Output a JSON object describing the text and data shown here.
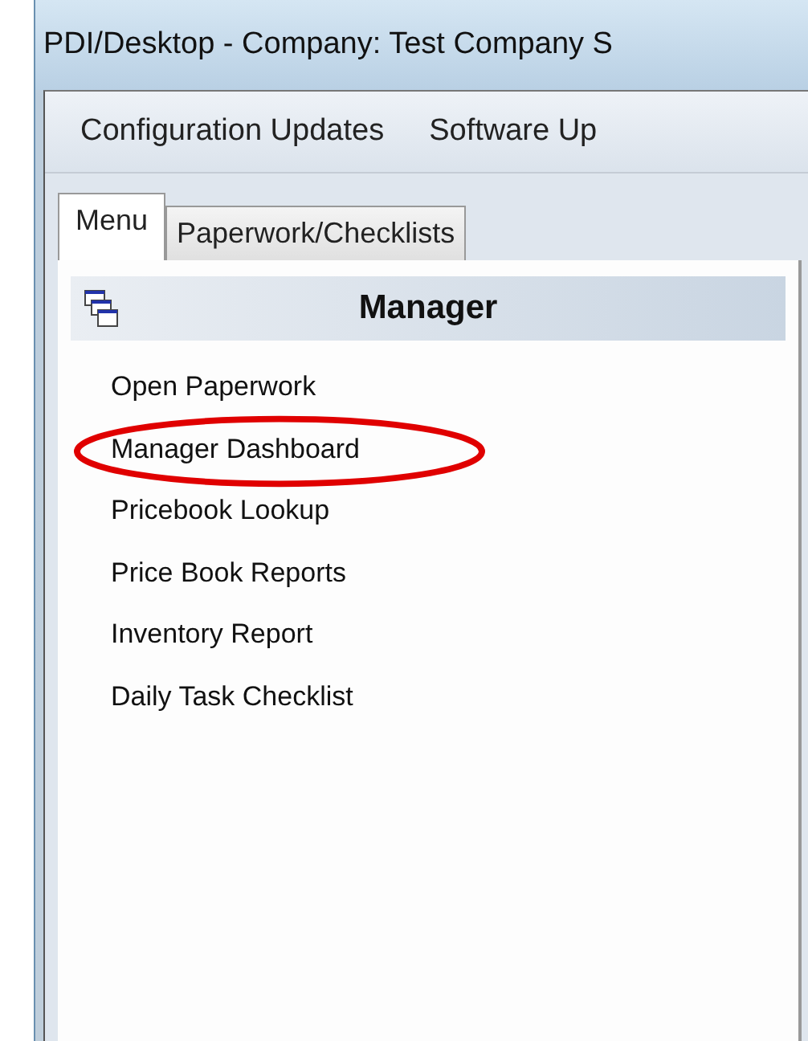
{
  "window": {
    "title": "PDI/Desktop - Company: Test Company S"
  },
  "menu_bar": {
    "items": [
      "Configuration Updates",
      "Software Up"
    ]
  },
  "tabs": [
    {
      "label": "Menu",
      "selected": true
    },
    {
      "label": "Paperwork/Checklists",
      "selected": false
    }
  ],
  "panel": {
    "title": "Manager",
    "items": [
      {
        "label": "Open Paperwork",
        "circled": false
      },
      {
        "label": "Manager Dashboard",
        "circled": true
      },
      {
        "label": "Pricebook Lookup",
        "circled": false
      },
      {
        "label": "Price Book Reports",
        "circled": false
      },
      {
        "label": "Inventory Report",
        "circled": false
      },
      {
        "label": "Daily Task Checklist",
        "circled": false
      }
    ]
  }
}
